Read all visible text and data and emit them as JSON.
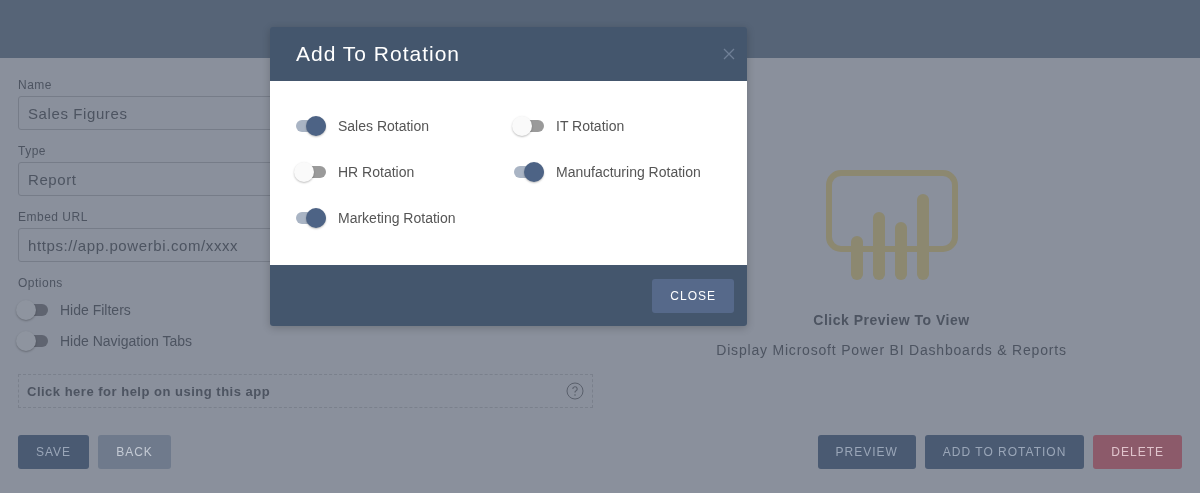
{
  "form": {
    "fields": [
      {
        "label": "Name",
        "value": "Sales Figures"
      },
      {
        "label": "Type",
        "value": "Report"
      },
      {
        "label": "Embed URL",
        "value": "https://app.powerbi.com/xxxx"
      }
    ],
    "options_label": "Options",
    "options": [
      {
        "label": "Hide Filters",
        "on": false
      },
      {
        "label": "Hide Navigation Tabs",
        "on": false
      }
    ],
    "help": "Click here for help on using this app"
  },
  "preview": {
    "title": "Click Preview To View",
    "subtitle": "Display Microsoft Power BI Dashboards & Reports"
  },
  "buttons_left": [
    {
      "label": "SAVE",
      "kind": "primary"
    },
    {
      "label": "BACK",
      "kind": "secondary"
    }
  ],
  "buttons_right": [
    {
      "label": "PREVIEW",
      "kind": "primary"
    },
    {
      "label": "ADD TO ROTATION",
      "kind": "primary"
    },
    {
      "label": "DELETE",
      "kind": "danger"
    }
  ],
  "modal": {
    "title": "Add To Rotation",
    "close_label": "CLOSE",
    "rotations": [
      {
        "label": "Sales Rotation",
        "on": true
      },
      {
        "label": "IT Rotation",
        "on": false
      },
      {
        "label": "HR Rotation",
        "on": false
      },
      {
        "label": "Manufacturing Rotation",
        "on": true
      },
      {
        "label": "Marketing Rotation",
        "on": true
      }
    ]
  }
}
